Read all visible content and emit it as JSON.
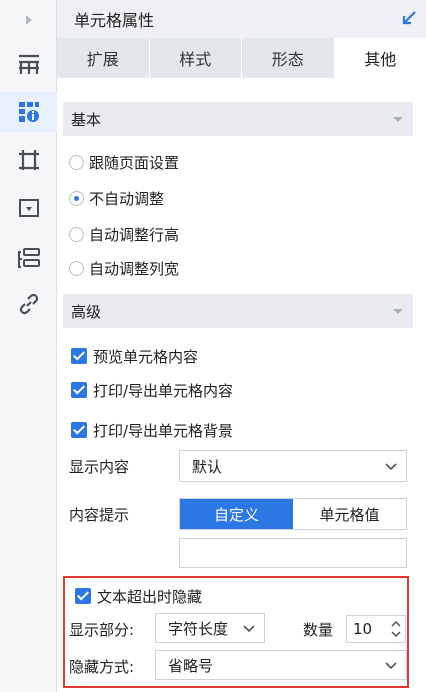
{
  "panel": {
    "title": "单元格属性"
  },
  "tabs": [
    {
      "label": "扩展",
      "active": false
    },
    {
      "label": "样式",
      "active": false
    },
    {
      "label": "形态",
      "active": false
    },
    {
      "label": "其他",
      "active": true
    }
  ],
  "basic": {
    "title": "基本",
    "options": [
      {
        "label": "跟随页面设置",
        "checked": false
      },
      {
        "label": "不自动调整",
        "checked": true
      },
      {
        "label": "自动调整行高",
        "checked": false
      },
      {
        "label": "自动调整列宽",
        "checked": false
      }
    ]
  },
  "advanced": {
    "title": "高级",
    "checks": [
      {
        "label": "预览单元格内容",
        "checked": true
      },
      {
        "label": "打印/导出单元格内容",
        "checked": true
      },
      {
        "label": "打印/导出单元格背景",
        "checked": true
      }
    ],
    "display_content_label": "显示内容",
    "display_content_value": "默认",
    "tooltip_label": "内容提示",
    "tooltip_options": [
      "自定义",
      "单元格值"
    ],
    "tooltip_active": "自定义",
    "tooltip_text": ""
  },
  "overflow": {
    "hide_label": "文本超出时隐藏",
    "hide_checked": true,
    "display_part_label": "显示部分:",
    "display_part_value": "字符长度",
    "count_label": "数量",
    "count_value": "10",
    "hide_mode_label": "隐藏方式:",
    "hide_mode_value": "省略号"
  },
  "colors": {
    "accent": "#2b78e4",
    "highlight": "#e53935",
    "icon_gray": "#4a4f57"
  }
}
